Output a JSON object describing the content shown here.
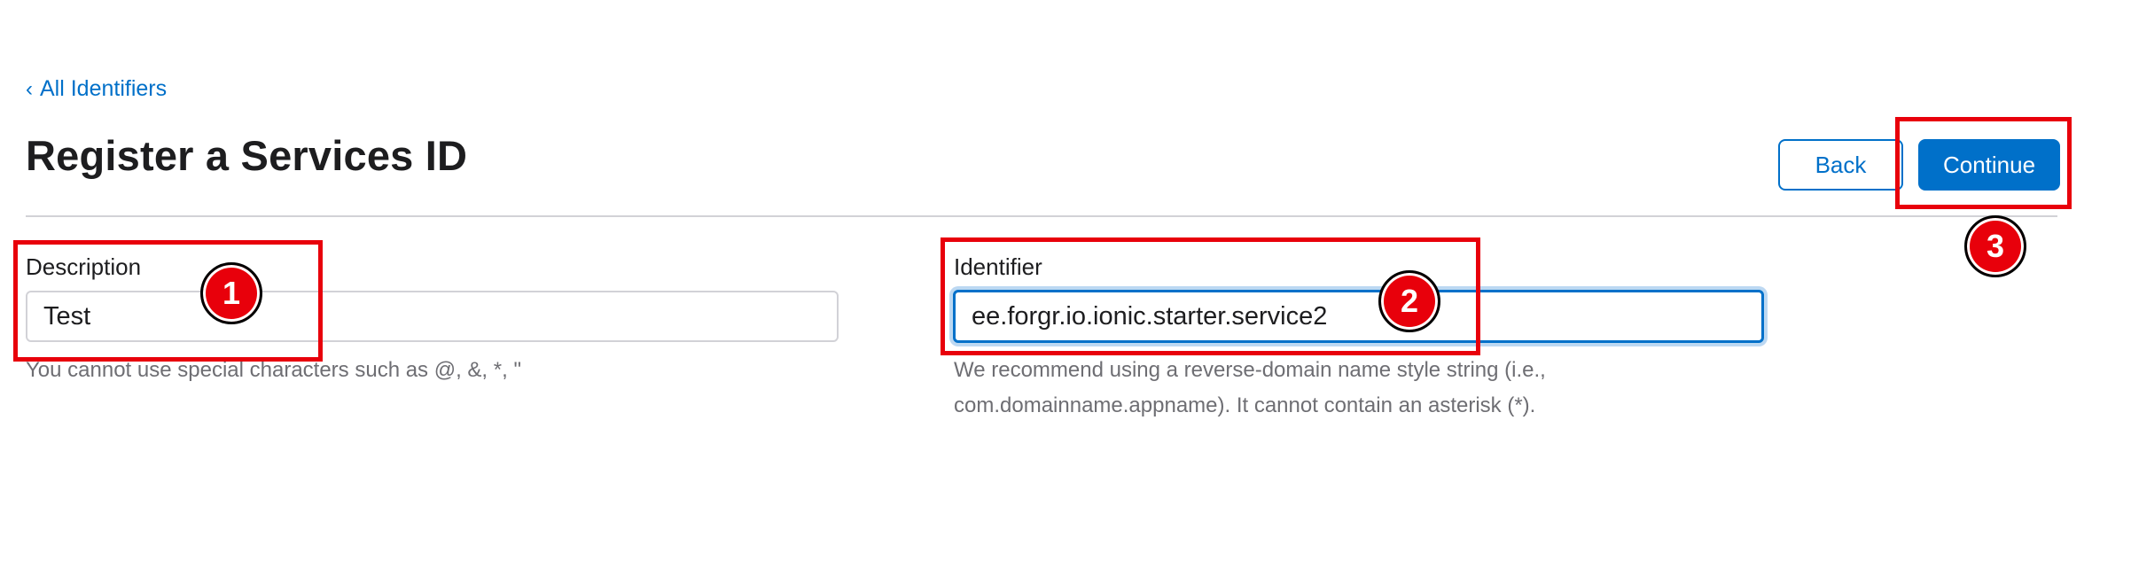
{
  "nav": {
    "back_link": "All Identifiers",
    "back_icon": "chevron-left-icon"
  },
  "header": {
    "title": "Register a Services ID",
    "back_button": "Back",
    "continue_button": "Continue"
  },
  "form": {
    "description": {
      "label": "Description",
      "value": "Test",
      "help": "You cannot use special characters such as @, &, *, \""
    },
    "identifier": {
      "label": "Identifier",
      "value": "ee.forgr.io.ionic.starter.service2",
      "help": "We recommend using a reverse-domain name style string (i.e., com.domainname.appname). It cannot contain an asterisk (*)."
    }
  },
  "annotations": {
    "step1": "1",
    "step2": "2",
    "step3": "3",
    "color": "#e8000b"
  },
  "colors": {
    "accent": "#0070c9",
    "divider": "#d2d2d7",
    "help_text": "#6e6e73"
  }
}
